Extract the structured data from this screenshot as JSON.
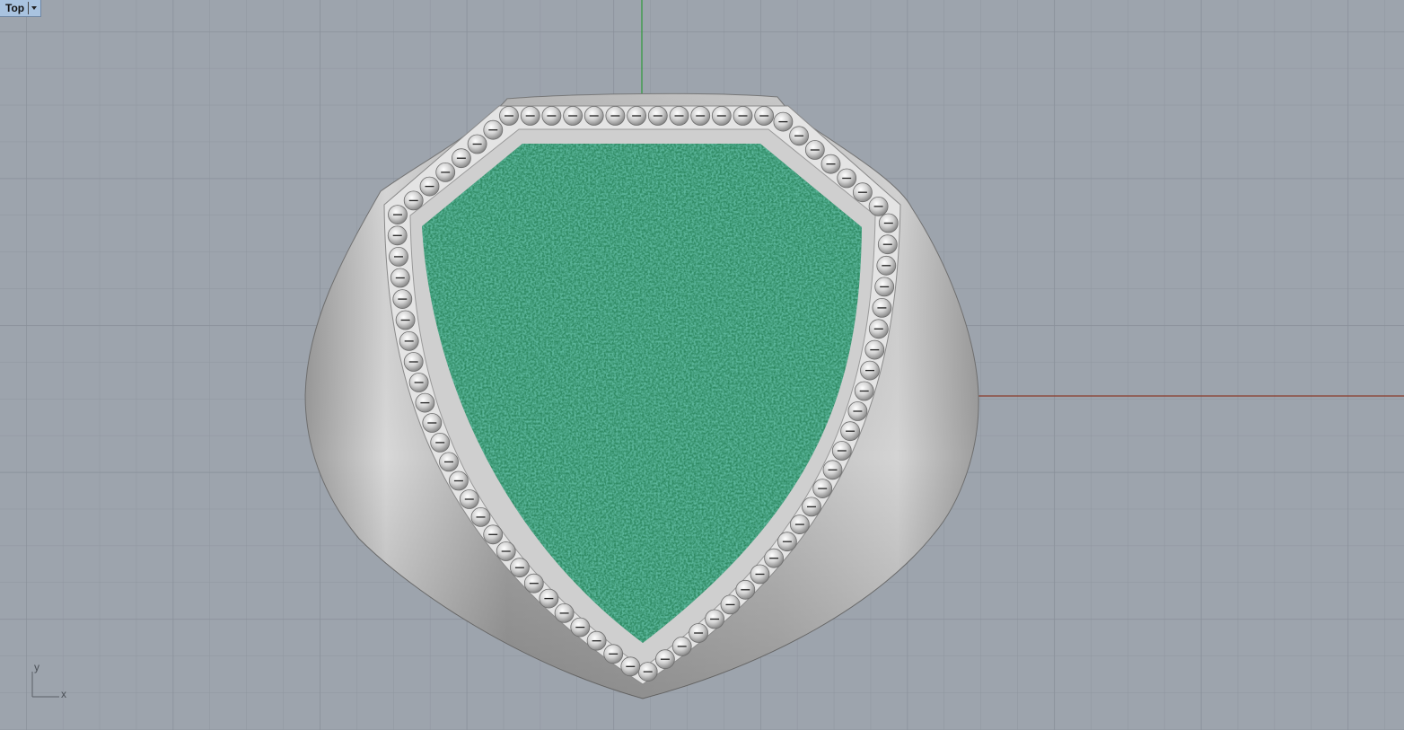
{
  "viewport": {
    "title": "Top",
    "menu_icon": "chevron-down-icon"
  },
  "axis_gizmo": {
    "x_label": "x",
    "y_label": "y"
  },
  "scene": {
    "grid_color": "#8e959e",
    "background_color": "#9da4ad",
    "x_axis_color": "#8a3a2a",
    "y_axis_color": "#2e9a3a",
    "ring_metal_color": "#c9c9c9",
    "inlay_color": "#2f8a63"
  }
}
